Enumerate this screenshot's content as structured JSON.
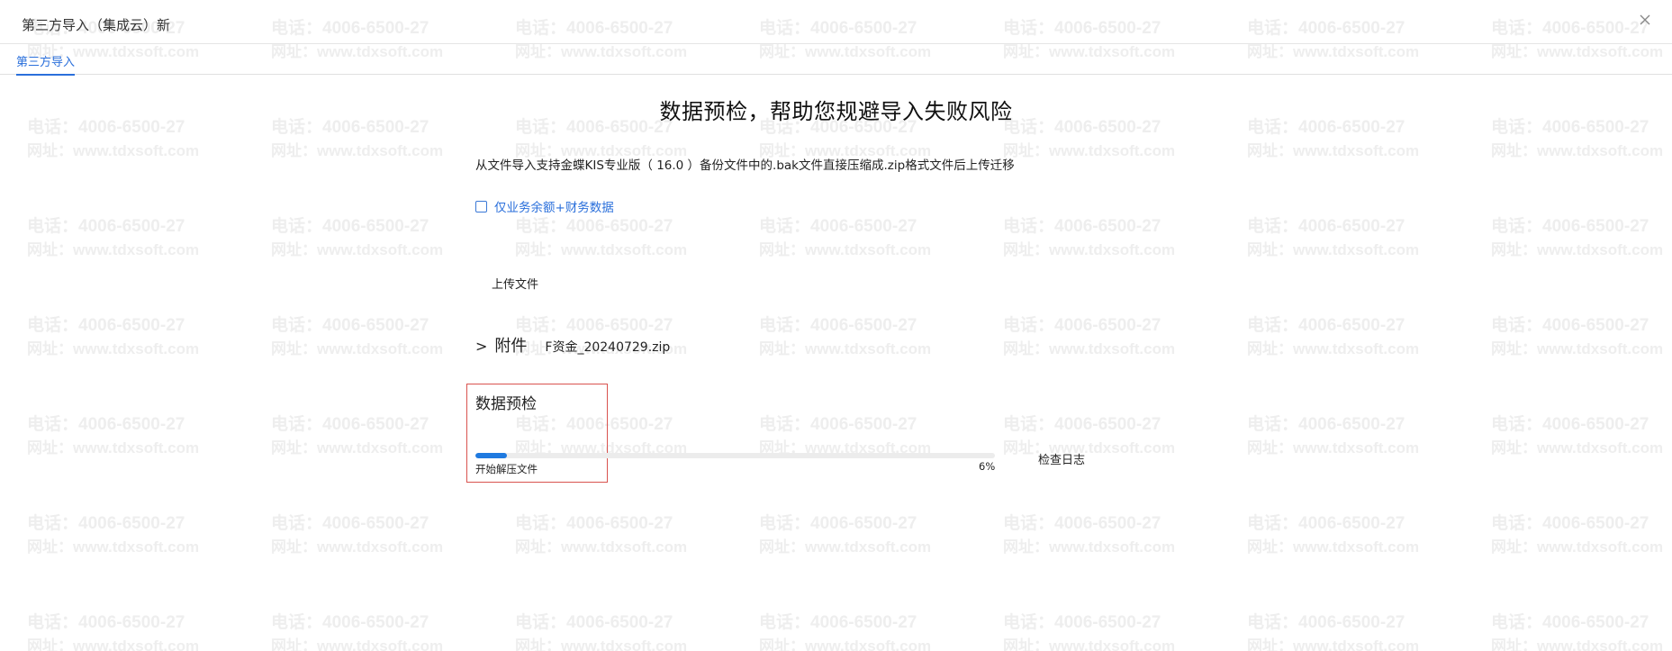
{
  "window": {
    "title": "第三方导入（集成云）新",
    "close_icon": "close-icon"
  },
  "tabs": [
    {
      "label": "第三方导入",
      "active": true
    }
  ],
  "main": {
    "heading": "数据预检，帮助您规避导入失败风险",
    "description": "从文件导入支持金蝶KIS专业版（ 16.0 ）备份文件中的.bak文件直接压缩成.zip格式文件后上传迁移",
    "checkbox": {
      "label": "仅业务余额+财务数据",
      "checked": false
    },
    "upload_label": "上传文件",
    "attachment": {
      "chevron": ">",
      "label": "附件",
      "file_name": "F资金_20240729.zip"
    },
    "precheck": {
      "title": "数据预检",
      "status_text": "开始解压文件",
      "progress": 6,
      "progress_label": "6%",
      "log_link": "检查日志"
    }
  },
  "watermark": {
    "phone": "电话：4006-6500-27",
    "site": "网址：www.tdxsoft.com"
  },
  "colors": {
    "accent": "#2a6fdb",
    "progress": "#1f7ae0",
    "highlight_border": "#d9534f"
  }
}
